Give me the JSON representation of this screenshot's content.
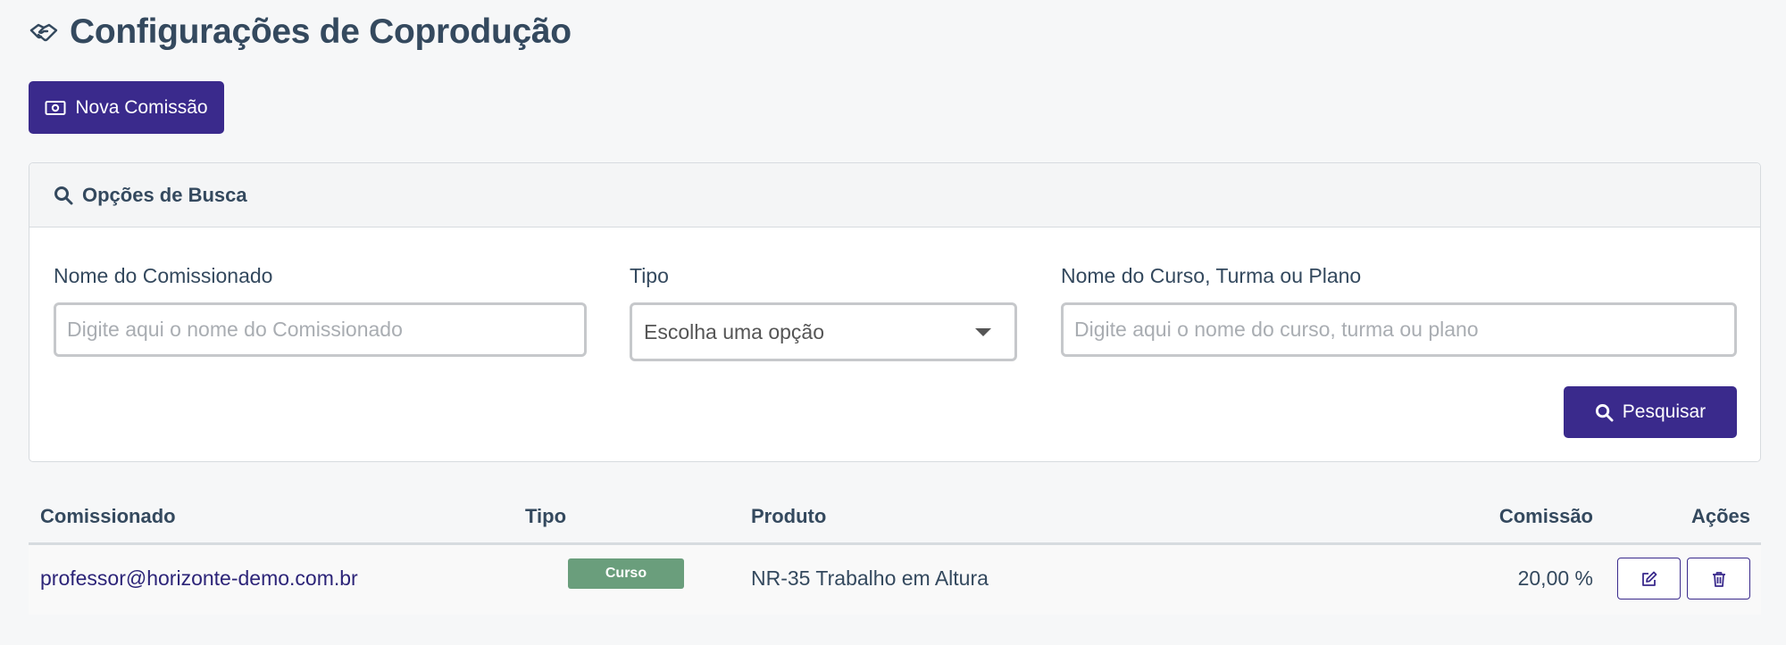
{
  "header": {
    "title": "Configurações de Coprodução",
    "icon": "handshake-icon"
  },
  "new_button": {
    "label": "Nova Comissão",
    "icon": "money-bill-icon"
  },
  "search": {
    "title": "Opções de Busca",
    "fields": {
      "comissionado": {
        "label": "Nome do Comissionado",
        "placeholder": "Digite aqui o nome do Comissionado",
        "value": ""
      },
      "tipo": {
        "label": "Tipo",
        "selected": "Escolha uma opção"
      },
      "produto": {
        "label": "Nome do Curso, Turma ou Plano",
        "placeholder": "Digite aqui o nome do curso, turma ou plano",
        "value": ""
      }
    },
    "submit_label": "Pesquisar"
  },
  "table": {
    "columns": [
      "Comissionado",
      "Tipo",
      "Produto",
      "Comissão",
      "Ações"
    ],
    "rows": [
      {
        "comissionado": "professor@horizonte-demo.com.br",
        "tipo": "Curso",
        "produto": "NR-35 Trabalho em Altura",
        "comissao": "20,00 %"
      }
    ]
  },
  "colors": {
    "primary": "#3a2a8c",
    "text": "#34495e",
    "badge": "#6a9e7c"
  }
}
